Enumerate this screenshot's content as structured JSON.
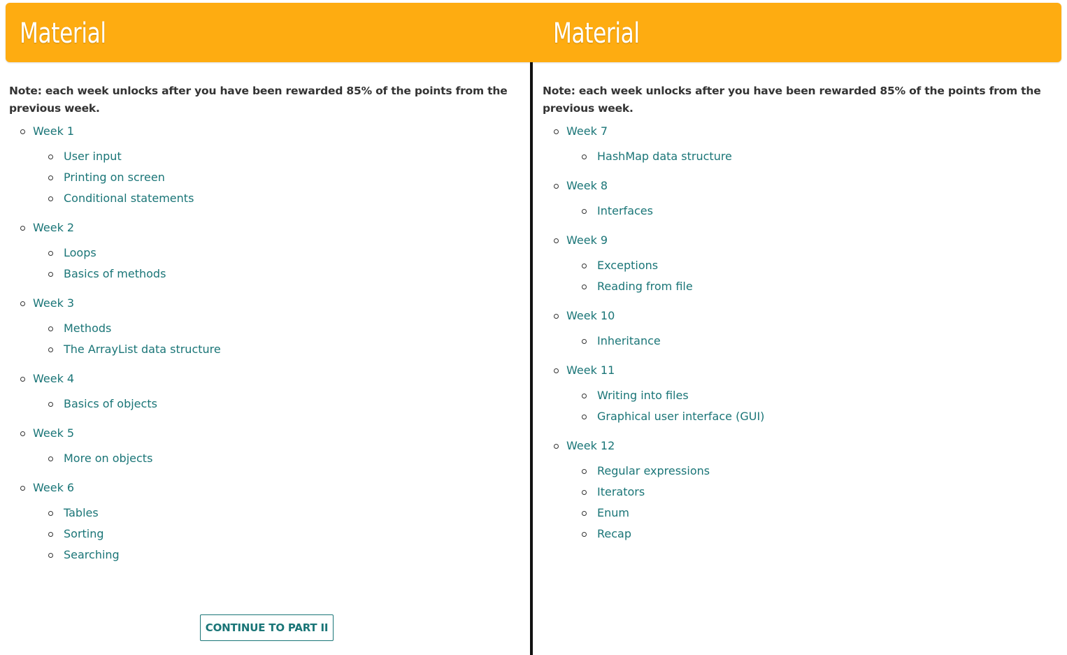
{
  "colors": {
    "header_bg": "#feac11",
    "link": "#1a7577",
    "text": "#333333",
    "divider": "#111111"
  },
  "left": {
    "title": "Material",
    "note": "Note: each week unlocks after you have been rewarded 85% of the points from the previous week.",
    "weeks": [
      {
        "label": "Week 1",
        "topics": [
          "User input",
          "Printing on screen",
          "Conditional statements"
        ]
      },
      {
        "label": "Week 2",
        "topics": [
          "Loops",
          "Basics of methods"
        ]
      },
      {
        "label": "Week 3",
        "topics": [
          "Methods",
          "The ArrayList data structure"
        ]
      },
      {
        "label": "Week 4",
        "topics": [
          "Basics of objects"
        ]
      },
      {
        "label": "Week 5",
        "topics": [
          "More on objects"
        ]
      },
      {
        "label": "Week 6",
        "topics": [
          "Tables",
          "Sorting",
          "Searching"
        ]
      }
    ],
    "continue_label": "CONTINUE TO PART II"
  },
  "right": {
    "title": "Material",
    "note": "Note: each week unlocks after you have been rewarded 85% of the points from the previous week.",
    "weeks": [
      {
        "label": "Week 7",
        "topics": [
          "HashMap data structure"
        ]
      },
      {
        "label": "Week 8",
        "topics": [
          "Interfaces"
        ]
      },
      {
        "label": "Week 9",
        "topics": [
          "Exceptions",
          "Reading from file"
        ]
      },
      {
        "label": "Week 10",
        "topics": [
          "Inheritance"
        ]
      },
      {
        "label": "Week 11",
        "topics": [
          "Writing into files",
          "Graphical user interface (GUI)"
        ]
      },
      {
        "label": "Week 12",
        "topics": [
          "Regular expressions",
          "Iterators",
          "Enum",
          "Recap"
        ]
      }
    ]
  }
}
